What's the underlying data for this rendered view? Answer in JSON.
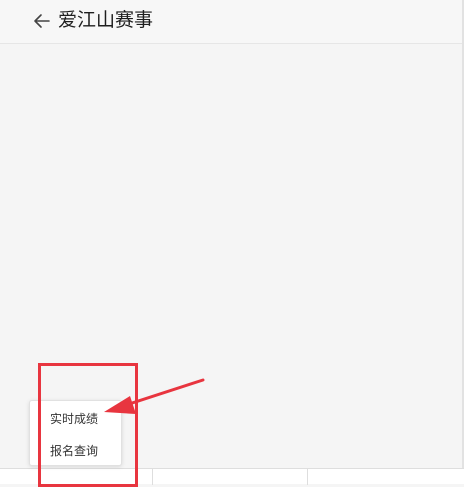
{
  "header": {
    "back_icon": "arrow-left-icon",
    "title": "爱江山赛事"
  },
  "popup_menu": {
    "items": [
      {
        "label": "实时成绩"
      },
      {
        "label": "报名查询"
      }
    ]
  },
  "annotation": {
    "highlight_color": "#e8353f",
    "arrow_color": "#e8353f",
    "arrow_icon": "red-arrow-annotation"
  }
}
